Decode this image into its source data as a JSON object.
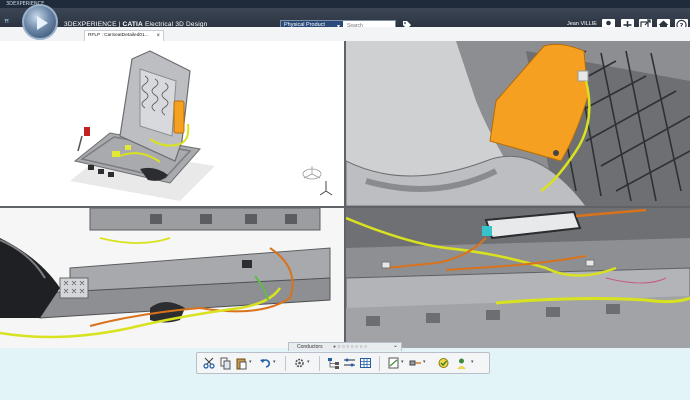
{
  "window": {
    "title": "3DEXPERIENCE"
  },
  "header": {
    "brand": "3DEXPERIENCE",
    "separator": "|",
    "product": "CATIA",
    "app_name": "Electrical 3D Design",
    "search": {
      "scope": "Physical Product",
      "placeholder": "Search"
    },
    "user": "Jean VILLIE"
  },
  "tabs": [
    {
      "label": "RFLP : CarSeatDetailed01..."
    }
  ],
  "action_bar": {
    "section_label": "Conductors"
  },
  "icons": {
    "compass": "compass-icon",
    "ds_logo": "3ds-logo-icon",
    "tag": "tag-icon",
    "profile": "user-profile-icon",
    "add": "plus-icon",
    "share": "share-icon",
    "home": "home-icon",
    "help": "help-icon"
  },
  "colors": {
    "topbar": "#2c3440",
    "wire_yellow": "#d9e21f",
    "wire_orange": "#d8731c",
    "connector_orange": "#f5a021",
    "viewport_bg": "#ffffff"
  }
}
